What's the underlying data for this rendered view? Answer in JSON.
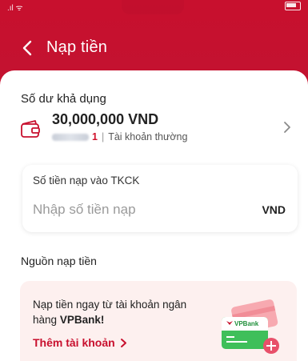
{
  "status_bar": {
    "signal_text": ".ıl ᯤ"
  },
  "header": {
    "title": "Nạp tiền"
  },
  "balance": {
    "label": "Số dư khả dụng",
    "amount": "30,000,000 VND",
    "account_suffix": "1",
    "separator": "|",
    "account_type": "Tài khoản thường"
  },
  "deposit": {
    "label": "Số tiền nạp vào TKCK",
    "placeholder": "Nhập số tiền nạp",
    "currency": "VND"
  },
  "source": {
    "label": "Nguồn nạp tiền"
  },
  "promo": {
    "text": "Nạp tiền ngay từ tài khoản ngân hàng",
    "bank": "VPBank!",
    "add_label": "Thêm tài khoản",
    "logo_text": "VPBank"
  },
  "colors": {
    "brand": "#c8102e",
    "promo_bg": "#fdf0ef",
    "card_green": "#3fbf5a"
  }
}
